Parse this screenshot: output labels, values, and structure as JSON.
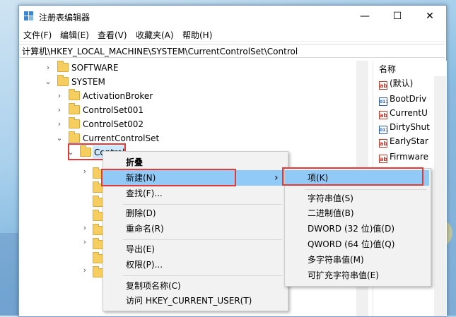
{
  "window": {
    "title": "注册表编辑器",
    "controls": {
      "minimize": "—",
      "maximize": "☐",
      "close": "✕"
    }
  },
  "menubar": [
    "文件(F)",
    "编辑(E)",
    "查看(V)",
    "收藏夹(A)",
    "帮助(H)"
  ],
  "address": "计算机\\HKEY_LOCAL_MACHINE\\SYSTEM\\CurrentControlSet\\Control",
  "tree": [
    {
      "label": "SOFTWARE",
      "expanded": false
    },
    {
      "label": "SYSTEM",
      "expanded": true
    },
    {
      "label": "ActivationBroker",
      "expanded": false
    },
    {
      "label": "ControlSet001",
      "expanded": false
    },
    {
      "label": "ControlSet002",
      "expanded": false
    },
    {
      "label": "CurrentControlSet",
      "expanded": true
    },
    {
      "label": "Control",
      "expanded": true,
      "selected": true
    }
  ],
  "values_pane": {
    "header": "名称",
    "items": [
      {
        "icon": "string-value-icon",
        "name": "(默认)"
      },
      {
        "icon": "binary-value-icon",
        "name": "BootDriv"
      },
      {
        "icon": "string-value-icon",
        "name": "CurrentU"
      },
      {
        "icon": "binary-value-icon",
        "name": "DirtyShut"
      },
      {
        "icon": "string-value-icon",
        "name": "EarlyStar"
      },
      {
        "icon": "string-value-icon",
        "name": "Firmware"
      }
    ]
  },
  "context_menu": {
    "items": [
      "折叠",
      "新建(N)",
      "查找(F)...",
      "删除(D)",
      "重命名(R)",
      "导出(E)",
      "权限(P)...",
      "复制项名称(C)",
      "访问 HKEY_CURRENT_USER(T)"
    ],
    "submenu_arrow": "›"
  },
  "submenu": {
    "items": [
      "项(K)",
      "字符串值(S)",
      "二进制值(B)",
      "DWORD (32 位)值(D)",
      "QWORD (64 位)值(Q)",
      "多字符串值(M)",
      "可扩充字符串值(E)"
    ]
  },
  "colors": {
    "highlight": "#91c9f7",
    "annotation_red": "#e53935",
    "folder": "#f6ce60"
  }
}
